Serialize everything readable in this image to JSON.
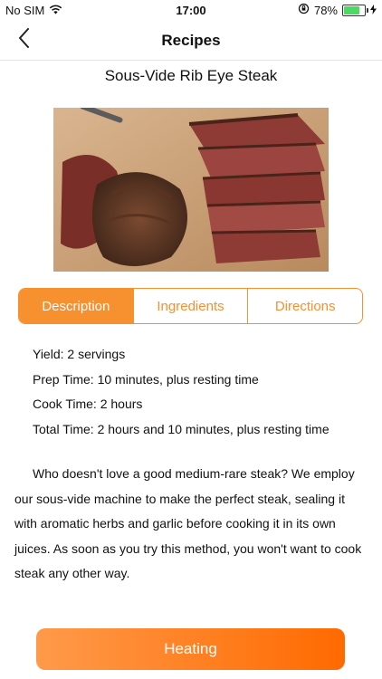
{
  "status_bar": {
    "carrier": "No SIM",
    "time": "17:00",
    "battery_percent": "78%",
    "battery_level": 0.78,
    "icons": [
      "wifi-icon",
      "orientation-lock-icon",
      "battery-icon",
      "charging-bolt-icon"
    ]
  },
  "nav": {
    "title": "Recipes",
    "back_icon": "chevron-left-icon"
  },
  "recipe": {
    "title": "Sous-Vide Rib Eye Steak",
    "image": "sliced-steak-photo"
  },
  "tabs": [
    {
      "label": "Description",
      "active": true
    },
    {
      "label": "Ingredients",
      "active": false
    },
    {
      "label": "Directions",
      "active": false
    }
  ],
  "details": {
    "yield": "Yield: 2 servings",
    "prep_time": "Prep Time: 10 minutes, plus resting time",
    "cook_time": "Cook Time: 2 hours",
    "total_time": "Total Time: 2 hours and 10 minutes, plus resting time"
  },
  "description": "Who doesn't love a good medium-rare steak? We employ our sous-vide machine to make the perfect steak, sealing it with aromatic herbs and garlic before cooking it in its own juices. As soon as you try this method, you won't want to cook steak any other way.",
  "action": {
    "label": "Heating"
  },
  "colors": {
    "accent": "#f7902f",
    "button_start": "#ff9a4a",
    "button_end": "#ff6a00"
  }
}
